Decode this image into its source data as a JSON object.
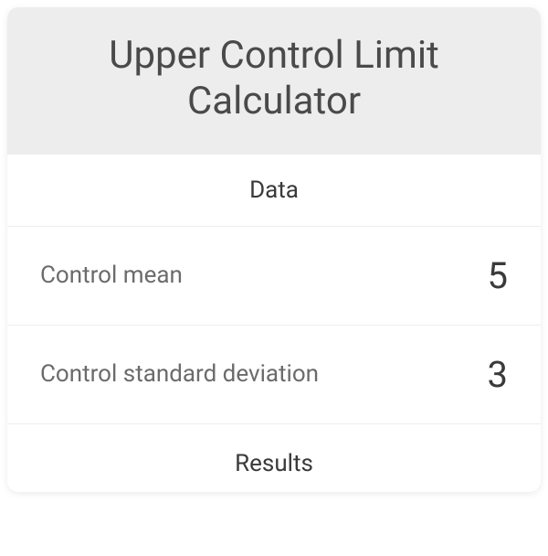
{
  "title": "Upper Control Limit Calculator",
  "sections": {
    "data": {
      "label": "Data",
      "rows": [
        {
          "label": "Control mean",
          "value": "5"
        },
        {
          "label": "Control standard deviation",
          "value": "3"
        }
      ]
    },
    "results": {
      "label": "Results"
    }
  }
}
